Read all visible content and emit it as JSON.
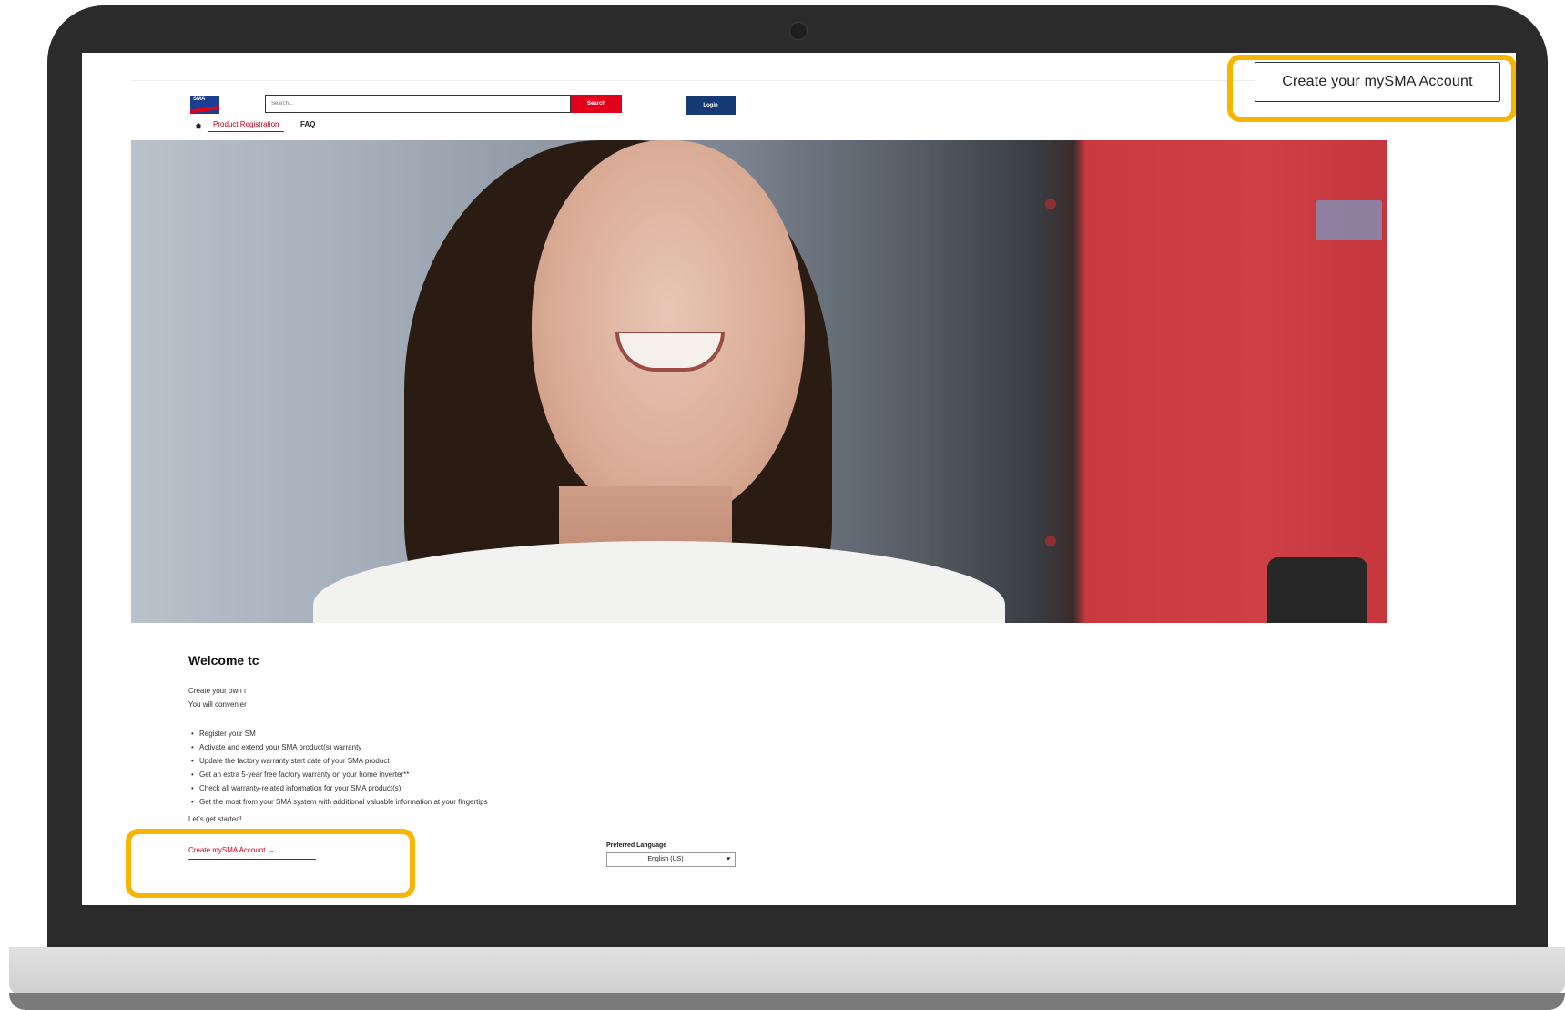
{
  "header": {
    "logo_text": "SMA",
    "search_placeholder": "Search...",
    "search_button_label": "Search",
    "login_button_label": "Login",
    "create_account_button_label": "Create your mySMA Account"
  },
  "nav": {
    "items": [
      {
        "label": "Product Registration",
        "active": true
      },
      {
        "label": "FAQ",
        "active": false
      }
    ]
  },
  "welcome": {
    "title": "Welcome tс",
    "intro_lines": [
      "Create your own ı",
      "You will convenier"
    ],
    "benefits": [
      "Register your SM",
      "Activate and extend your SMA product(s) warranty",
      "Update the factory warranty start date of your SMA product",
      "Get an extra 5-year free factory warranty on your home inverter**",
      "Check all warranty-related information for your SMA product(s)",
      "Get the most from your SMA system with additional valuable information at your fingertips"
    ],
    "lets_start": "Let's get started!",
    "create_account_link": "Create mySMA Account →"
  },
  "language": {
    "label": "Preferred Language",
    "selected": "English (US)"
  },
  "colors": {
    "brand_red": "#e2001a",
    "brand_blue": "#163a73",
    "highlight_yellow": "#f8b500"
  },
  "icons": {
    "home": "home-icon",
    "dropdown": "chevron-down-icon"
  }
}
